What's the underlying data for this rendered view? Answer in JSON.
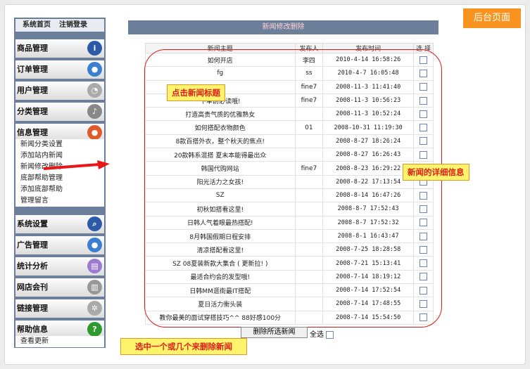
{
  "corner_tag": "后台页面",
  "topnav": {
    "home": "系统首页",
    "logout": "注销登录"
  },
  "sections": [
    {
      "label": "商品管理",
      "icon": "info-icon"
    },
    {
      "label": "订单管理",
      "icon": "globe-icon"
    },
    {
      "label": "用户管理",
      "icon": "clock-icon"
    },
    {
      "label": "分类管理",
      "icon": "music-icon"
    },
    {
      "label": "信息管理",
      "icon": "record-icon"
    },
    {
      "label": "系统设置",
      "icon": "search-icon"
    },
    {
      "label": "广告管理",
      "icon": "globe-icon"
    },
    {
      "label": "统计分析",
      "icon": "window-icon"
    },
    {
      "label": "网店会刊",
      "icon": "document-icon"
    },
    {
      "label": "链接管理",
      "icon": "gear-icon"
    },
    {
      "label": "帮助信息",
      "icon": "help-icon"
    }
  ],
  "info_sub": [
    "新闻分类设置",
    "添加站内新闻",
    "新闻修改删除",
    "底部帮助管理",
    "添加底部帮助",
    "管理留言"
  ],
  "help_sub": [
    "查看更新"
  ],
  "panel_title": "新闻修改删除",
  "headers": {
    "title": "新闻主题",
    "publisher": "发布人",
    "time": "发布时间",
    "select": "选 择"
  },
  "rows": [
    [
      "如何开店",
      "李四",
      "2010-4-14 16:58:26"
    ],
    [
      "fg",
      "ss",
      "2010-4-7 16:05:48"
    ],
    [
      "",
      "fine7",
      "2008-11-3 11:41:40"
    ],
    [
      "下单前必读哦!",
      "fine7",
      "2008-11-3 10:56:23"
    ],
    [
      "打造高贵气质的优雅熟女",
      "",
      "2008-11-3 10:52:24"
    ],
    [
      "如何搭配衣物颜色",
      "01",
      "2008-10-31 11:19:30"
    ],
    [
      "8款百搭外衣，整个秋天的焦点!",
      "",
      "2008-8-27 18:26:24"
    ],
    [
      "20款韩系混搭 夏末本能得最出众",
      "",
      "2008-8-27 16:26:43"
    ],
    [
      "韩国代购网站",
      "fine7",
      "2008-8-23 16:29:22"
    ],
    [
      "阳光活力之女孩!",
      "",
      "2008-8-22 17:13:54"
    ],
    [
      "SZ",
      "",
      "2008-8-14 16:47:26"
    ],
    [
      "初秋如搭看这里!",
      "",
      "2008-8-7 17:52:43"
    ],
    [
      "日韩人气着眼最热搭配!",
      "",
      "2008-8-7 17:52:32"
    ],
    [
      "8月韩国假期日程安排",
      "",
      "2008-8-1 16:43:47"
    ],
    [
      "清凉搭配看这里!",
      "",
      "2008-7-25 18:28:58"
    ],
    [
      "SZ 08夏装新款大集合 ( 更新拉! )",
      "",
      "2008-7-21 15:13:41"
    ],
    [
      "最适合约会的发型哦!",
      "",
      "2008-7-14 18:19:12"
    ],
    [
      "日韩MM逛街最IT搭配",
      "",
      "2008-7-14 17:52:54"
    ],
    [
      "夏日活力衝头装",
      "",
      "2008-7-14 17:48:55"
    ],
    [
      "教你最美的面试穿搭技巧^^ 88好感100分",
      "",
      "2008-7-14 15:54:50"
    ]
  ],
  "delete_button": "删除所选新闻",
  "select_all": "全选",
  "callouts": {
    "title_tip": "点击新闻标题",
    "detail_tip": "新闻的详细信息",
    "delete_tip": "选中一个或几个来删除新闻"
  },
  "colors": {
    "accent": "#f7931e",
    "sidebar": "#6b7e9a",
    "callout_text": "#e0201a",
    "callout_bg": "#fff36b"
  }
}
